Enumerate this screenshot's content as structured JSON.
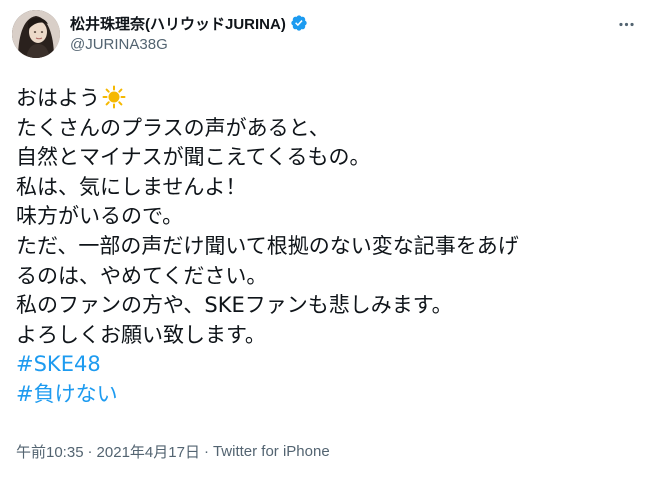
{
  "author": {
    "display_name": "松井珠理奈(ハリウッドJURINA)",
    "handle": "@JURINA38G",
    "verified_icon": "verified-badge-icon",
    "avatar": "profile-photo"
  },
  "more_icon": "more-horizontal-icon",
  "tweet": {
    "lines": [
      "おはよう",
      "たくさんのプラスの声があると、",
      "自然とマイナスが聞こえてくるもの。",
      "私は、気にしませんよ！",
      "味方がいるので。",
      "ただ、一部の声だけ聞いて根拠のない変な記事をあげ",
      "るのは、やめてください。",
      "私のファンの方や、SKEファンも悲しみます。",
      "よろしくお願い致します。"
    ],
    "emoji": "sun-emoji",
    "hashtags": [
      "#SKE48",
      "#負けない"
    ]
  },
  "meta": {
    "time": "午前10:35",
    "separator": "·",
    "date": "2021年4月17日",
    "source": "Twitter for iPhone"
  },
  "colors": {
    "link": "#1d9bf0",
    "secondary_text": "#536471",
    "primary_text": "#0f1419",
    "verified": "#1d9bf0",
    "sun": "#f5b800"
  }
}
